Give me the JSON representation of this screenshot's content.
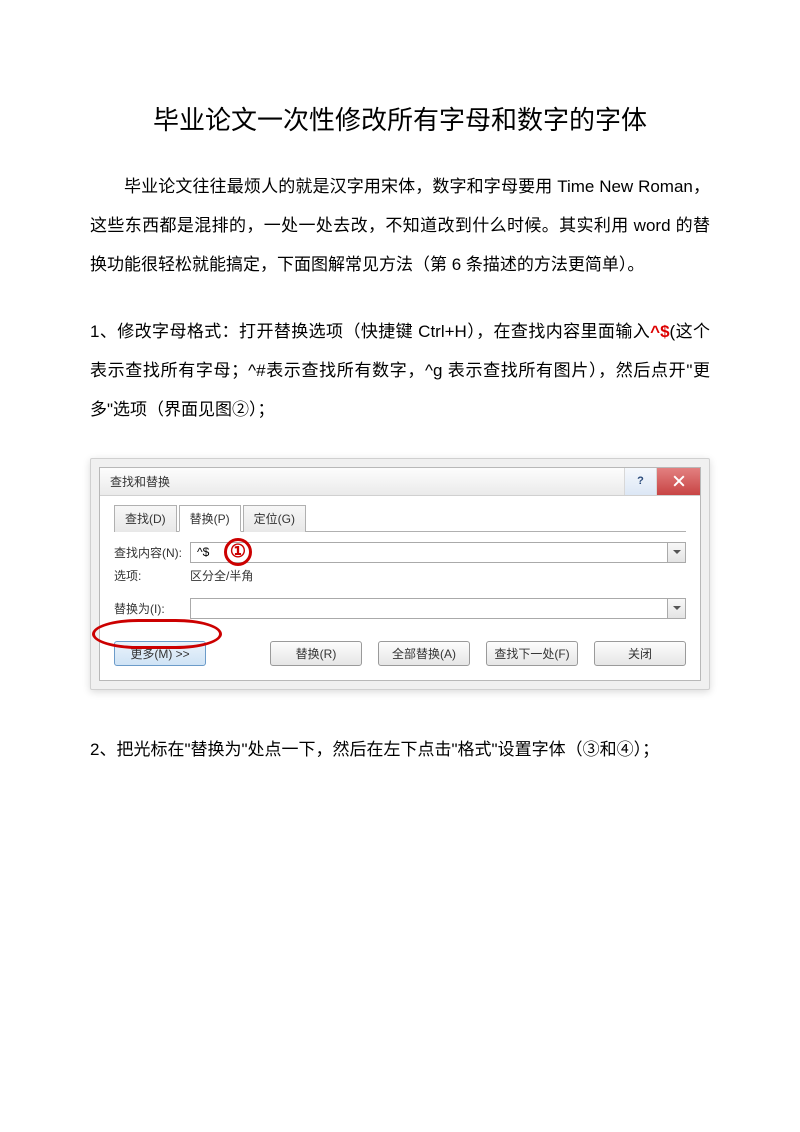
{
  "title": "毕业论文一次性修改所有字母和数字的字体",
  "intro": "毕业论文往往最烦人的就是汉字用宋体，数字和字母要用 Time New Roman，这些东西都是混排的，一处一处去改，不知道改到什么时候。其实利用 word 的替换功能很轻松就能搞定，下面图解常见方法（第 6 条描述的方法更简单）。",
  "step1_prefix": "1、修改字母格式：打开替换选项（快捷键 Ctrl+H），在查找内容里面输入",
  "step1_code": "^$",
  "step1_suffix": "(这个表示查找所有字母；^#表示查找所有数字，^g 表示查找所有图片），然后点开\"更多\"选项（界面见图②）；",
  "step2": "2、把光标在\"替换为\"处点一下，然后在左下点击\"格式\"设置字体（③和④）；",
  "dialog": {
    "title": "查找和替换",
    "help_label": "?",
    "tabs": {
      "find": "查找(D)",
      "replace": "替换(P)",
      "goto": "定位(G)"
    },
    "find_label": "查找内容(N):",
    "find_value": "^$",
    "options_label": "选项:",
    "options_value": "区分全/半角",
    "replace_label": "替换为(I):",
    "replace_value": "",
    "buttons": {
      "more": "更多(M) >>",
      "replace": "替换(R)",
      "replace_all": "全部替换(A)",
      "find_next": "查找下一处(F)",
      "close": "关闭"
    },
    "callout1": "①"
  }
}
